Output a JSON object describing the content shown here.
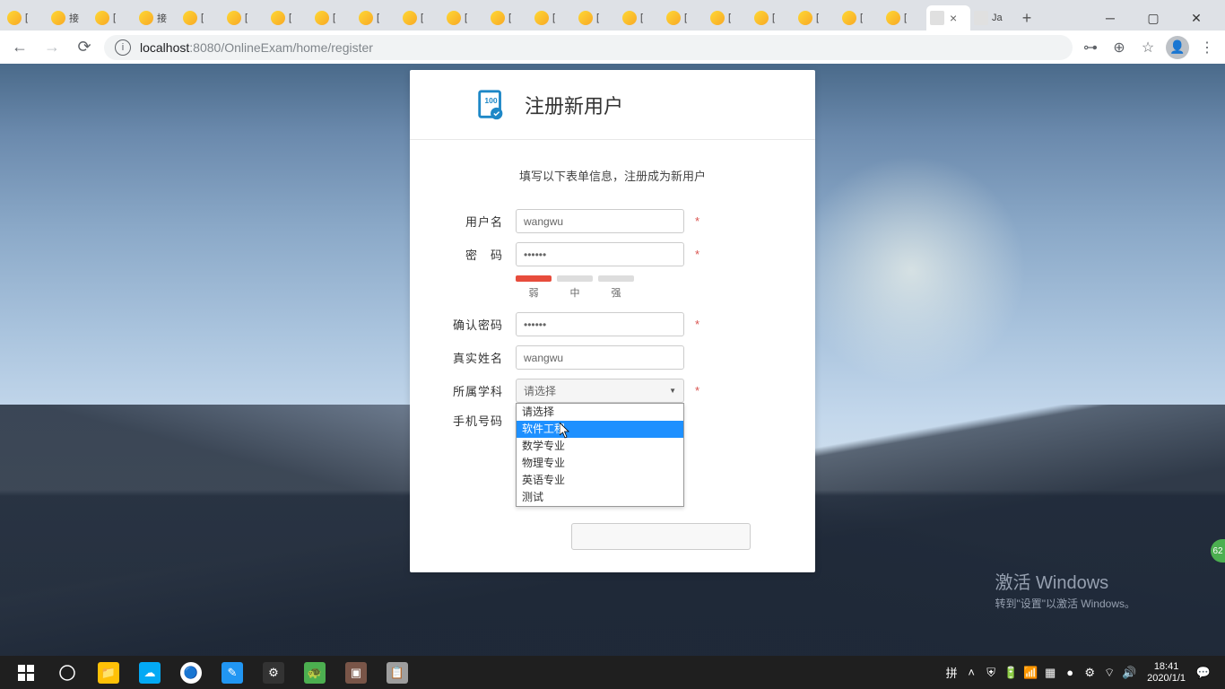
{
  "browser": {
    "tabs": [
      {
        "label": "["
      },
      {
        "label": "接"
      },
      {
        "label": "["
      },
      {
        "label": "接"
      },
      {
        "label": "["
      },
      {
        "label": "["
      },
      {
        "label": "["
      },
      {
        "label": "["
      },
      {
        "label": "["
      },
      {
        "label": "["
      },
      {
        "label": "["
      },
      {
        "label": "["
      },
      {
        "label": "["
      },
      {
        "label": "["
      },
      {
        "label": "["
      },
      {
        "label": "["
      },
      {
        "label": "["
      },
      {
        "label": "["
      },
      {
        "label": "["
      },
      {
        "label": "["
      },
      {
        "label": "["
      }
    ],
    "active_tab_label": "",
    "last_tab_label": "Ja",
    "url_host": "localhost",
    "url_port": ":8080",
    "url_path": "/OnlineExam/home/register"
  },
  "form": {
    "title": "注册新用户",
    "subtitle": "填写以下表单信息，注册成为新用户",
    "username_label": "用户名",
    "username_value": "wangwu",
    "password_label": "密　码",
    "password_value": "••••••",
    "strength_weak": "弱",
    "strength_mid": "中",
    "strength_strong": "强",
    "confirm_label": "确认密码",
    "confirm_value": "••••••",
    "realname_label": "真实姓名",
    "realname_value": "wangwu",
    "subject_label": "所属学科",
    "subject_selected": "请选择",
    "phone_label": "手机号码",
    "required": "*",
    "dropdown_options": {
      "opt0": "请选择",
      "opt1": "软件工程",
      "opt2": "数学专业",
      "opt3": "物理专业",
      "opt4": "英语专业",
      "opt5": "测试"
    }
  },
  "watermark": {
    "title": "激活 Windows",
    "sub": "转到\"设置\"以激活 Windows。"
  },
  "badge": "62",
  "taskbar": {
    "time": "18:41",
    "date": "2020/1/1"
  }
}
